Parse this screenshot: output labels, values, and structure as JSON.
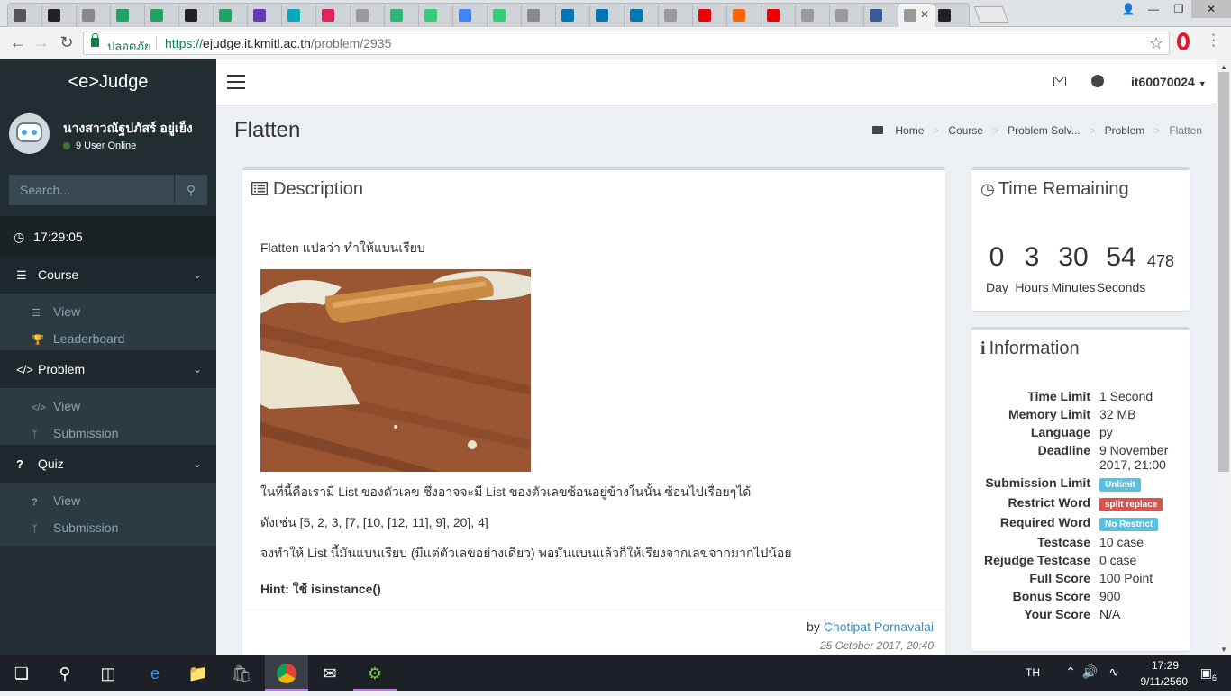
{
  "browser": {
    "tabs": [
      {
        "color": "#555"
      },
      {
        "color": "#222"
      },
      {
        "color": "#888"
      },
      {
        "color": "#1fa463"
      },
      {
        "color": "#1fa463"
      },
      {
        "color": "#222"
      },
      {
        "color": "#1fa463"
      },
      {
        "color": "#673ab7"
      },
      {
        "color": "#0ab"
      },
      {
        "color": "#e0245e"
      },
      {
        "color": "#999"
      },
      {
        "color": "#2bb673"
      },
      {
        "color": "#3c7"
      },
      {
        "color": "#4285f4"
      },
      {
        "color": "#3c7"
      },
      {
        "color": "#888"
      },
      {
        "color": "#0077b5"
      },
      {
        "color": "#0077b5"
      },
      {
        "color": "#0077b5"
      },
      {
        "color": "#999"
      },
      {
        "color": "#e00"
      },
      {
        "color": "#f60"
      },
      {
        "color": "#e00"
      },
      {
        "color": "#999"
      },
      {
        "color": "#999"
      },
      {
        "color": "#3b5998"
      },
      {
        "color": "#999",
        "active": true
      },
      {
        "color": "#222"
      }
    ],
    "secure_label": "ปลอดภัย",
    "url_scheme": "https://",
    "url_host": "ejudge.it.kmitl.ac.th",
    "url_path": "/problem/2935"
  },
  "sidebar": {
    "brand": "<e>Judge",
    "user_name": "นางสาวณัฐปภัสร์ อยู่เย็ง",
    "online": "9 User Online",
    "search_placeholder": "Search...",
    "clock": "17:29:05",
    "sections": [
      {
        "label": "Course",
        "items": [
          {
            "label": "View",
            "icon": "list-icon"
          },
          {
            "label": "Leaderboard",
            "icon": "trophy-icon"
          }
        ]
      },
      {
        "label": "Problem",
        "items": [
          {
            "label": "View",
            "icon": "code-icon"
          },
          {
            "label": "Submission",
            "icon": "branch-icon"
          }
        ]
      },
      {
        "label": "Quiz",
        "items": [
          {
            "label": "View",
            "icon": "question-icon"
          },
          {
            "label": "Submission",
            "icon": "branch-icon"
          }
        ]
      }
    ]
  },
  "topnav": {
    "account": "it60070024"
  },
  "page": {
    "title": "Flatten",
    "breadcrumb": [
      "Home",
      "Course",
      "Problem Solv...",
      "Problem",
      "Flatten"
    ]
  },
  "description": {
    "heading": "Description",
    "intro": "Flatten แปลว่า ทำให้แบนเรียบ",
    "para1": "ในที่นี้คือเรามี List ของตัวเลข ซึ่งอาจจะมี List ของตัวเลขซ้อนอยู่ข้างในนั้น ซ้อนไปเรื่อยๆได้",
    "para2": "ดังเช่น [5, 2, 3, [7, [10, [12, 11], 9], 20], 4]",
    "para3": "จงทำให้ List นี้มันแบนเรียบ (มีแต่ตัวเลขอย่างเดียว) พอมันแบนแล้วก็ให้เรียงจากเลขจากมากไปน้อย",
    "hint": "Hint: ใช้ isinstance()",
    "by": "by",
    "author": "Chotipat Pornavalai",
    "posted": "25 October 2017, 20:40"
  },
  "time_remaining": {
    "heading": "Time Remaining",
    "day": "0",
    "hours": "3",
    "minutes": "30",
    "seconds": "54",
    "ms": "478",
    "day_label": "Day",
    "hours_label": "Hours",
    "minutes_label": "Minutes",
    "seconds_label": "Seconds"
  },
  "information": {
    "heading": "Information",
    "rows": [
      {
        "k": "Time Limit",
        "v": "1 Second"
      },
      {
        "k": "Memory Limit",
        "v": "32 MB"
      },
      {
        "k": "Language",
        "v": "py"
      },
      {
        "k": "Deadline",
        "v": "9 November 2017, 21:00"
      },
      {
        "k": "Submission Limit",
        "v": "Unlimit",
        "badge": "#5bc0de"
      },
      {
        "k": "Restrict Word",
        "v": "split replace",
        "badge": "#d9534f"
      },
      {
        "k": "Required Word",
        "v": "No Restrict",
        "badge": "#5bc0de"
      },
      {
        "k": "Testcase",
        "v": "10 case"
      },
      {
        "k": "Rejudge Testcase",
        "v": "0 case"
      },
      {
        "k": "Full Score",
        "v": "100 Point"
      },
      {
        "k": "Bonus Score",
        "v": "900"
      },
      {
        "k": "Your Score",
        "v": "N/A"
      }
    ]
  },
  "taskbar": {
    "lang": "TH",
    "time": "17:29",
    "date": "9/11/2560",
    "notifications": "6"
  }
}
